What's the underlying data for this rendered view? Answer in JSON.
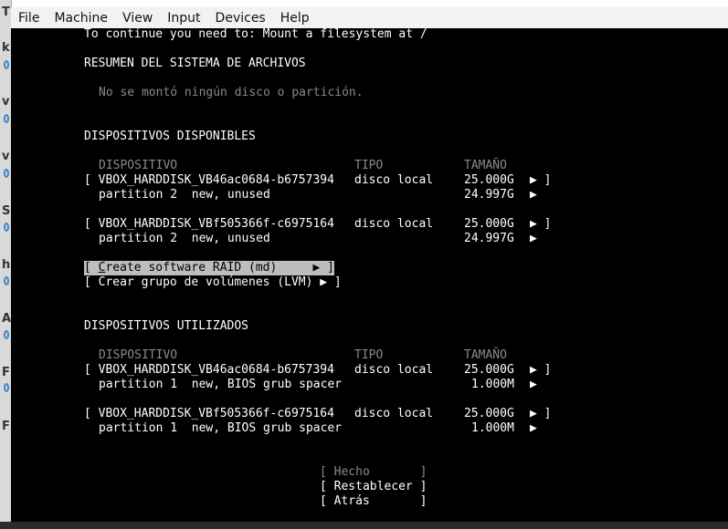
{
  "menu": [
    "File",
    "Machine",
    "View",
    "Input",
    "Devices",
    "Help"
  ],
  "left_strip_letters": [
    "T",
    "k",
    "v",
    "v",
    "S",
    "h",
    "A",
    "F",
    "F"
  ],
  "terminal": {
    "continue_msg": "To continue you need to: Mount a filesystem at /",
    "fs_summary_title": "RESUMEN DEL SISTEMA DE ARCHIVOS",
    "no_mount_msg": "No se montó ningún disco o partición.",
    "available_title": "DISPOSITIVOS DISPONIBLES",
    "col_device": "DISPOSITIVO",
    "col_type": "TIPO",
    "col_size": "TAMAÑO",
    "available": [
      {
        "disk": "[ VBOX_HARDDISK_VB46ac0684-b6757394",
        "type": "disco local",
        "size": "25.000G",
        "arrow": "▶ ]",
        "part": "partition 2  new, unused",
        "part_size": "24.997G",
        "part_arrow": "▶"
      },
      {
        "disk": "[ VBOX_HARDDISK_VBf505366f-c6975164",
        "type": "disco local",
        "size": "25.000G",
        "arrow": "▶ ]",
        "part": "partition 2  new, unused",
        "part_size": "24.997G",
        "part_arrow": "▶"
      }
    ],
    "raid_prefix": "[ ",
    "raid_hotkey": "C",
    "raid_rest": "reate software RAID (md)     ▶ ]",
    "lvm": "[ Crear grupo de volúmenes (LVM) ▶ ]",
    "used_title": "DISPOSITIVOS UTILIZADOS",
    "used": [
      {
        "disk": "[ VBOX_HARDDISK_VB46ac0684-b6757394",
        "type": "disco local",
        "size": "25.000G",
        "arrow": "▶ ]",
        "part": "partition 1  new, BIOS grub spacer",
        "part_size": "1.000M",
        "part_arrow": "▶"
      },
      {
        "disk": "[ VBOX_HARDDISK_VBf505366f-c6975164",
        "type": "disco local",
        "size": "25.000G",
        "arrow": "▶ ]",
        "part": "partition 1  new, BIOS grub spacer",
        "part_size": "1.000M",
        "part_arrow": "▶"
      }
    ],
    "btn_done": "[ Hecho       ]",
    "btn_reset": "[ Restablecer ]",
    "btn_back": "[ Atrás       ]"
  }
}
